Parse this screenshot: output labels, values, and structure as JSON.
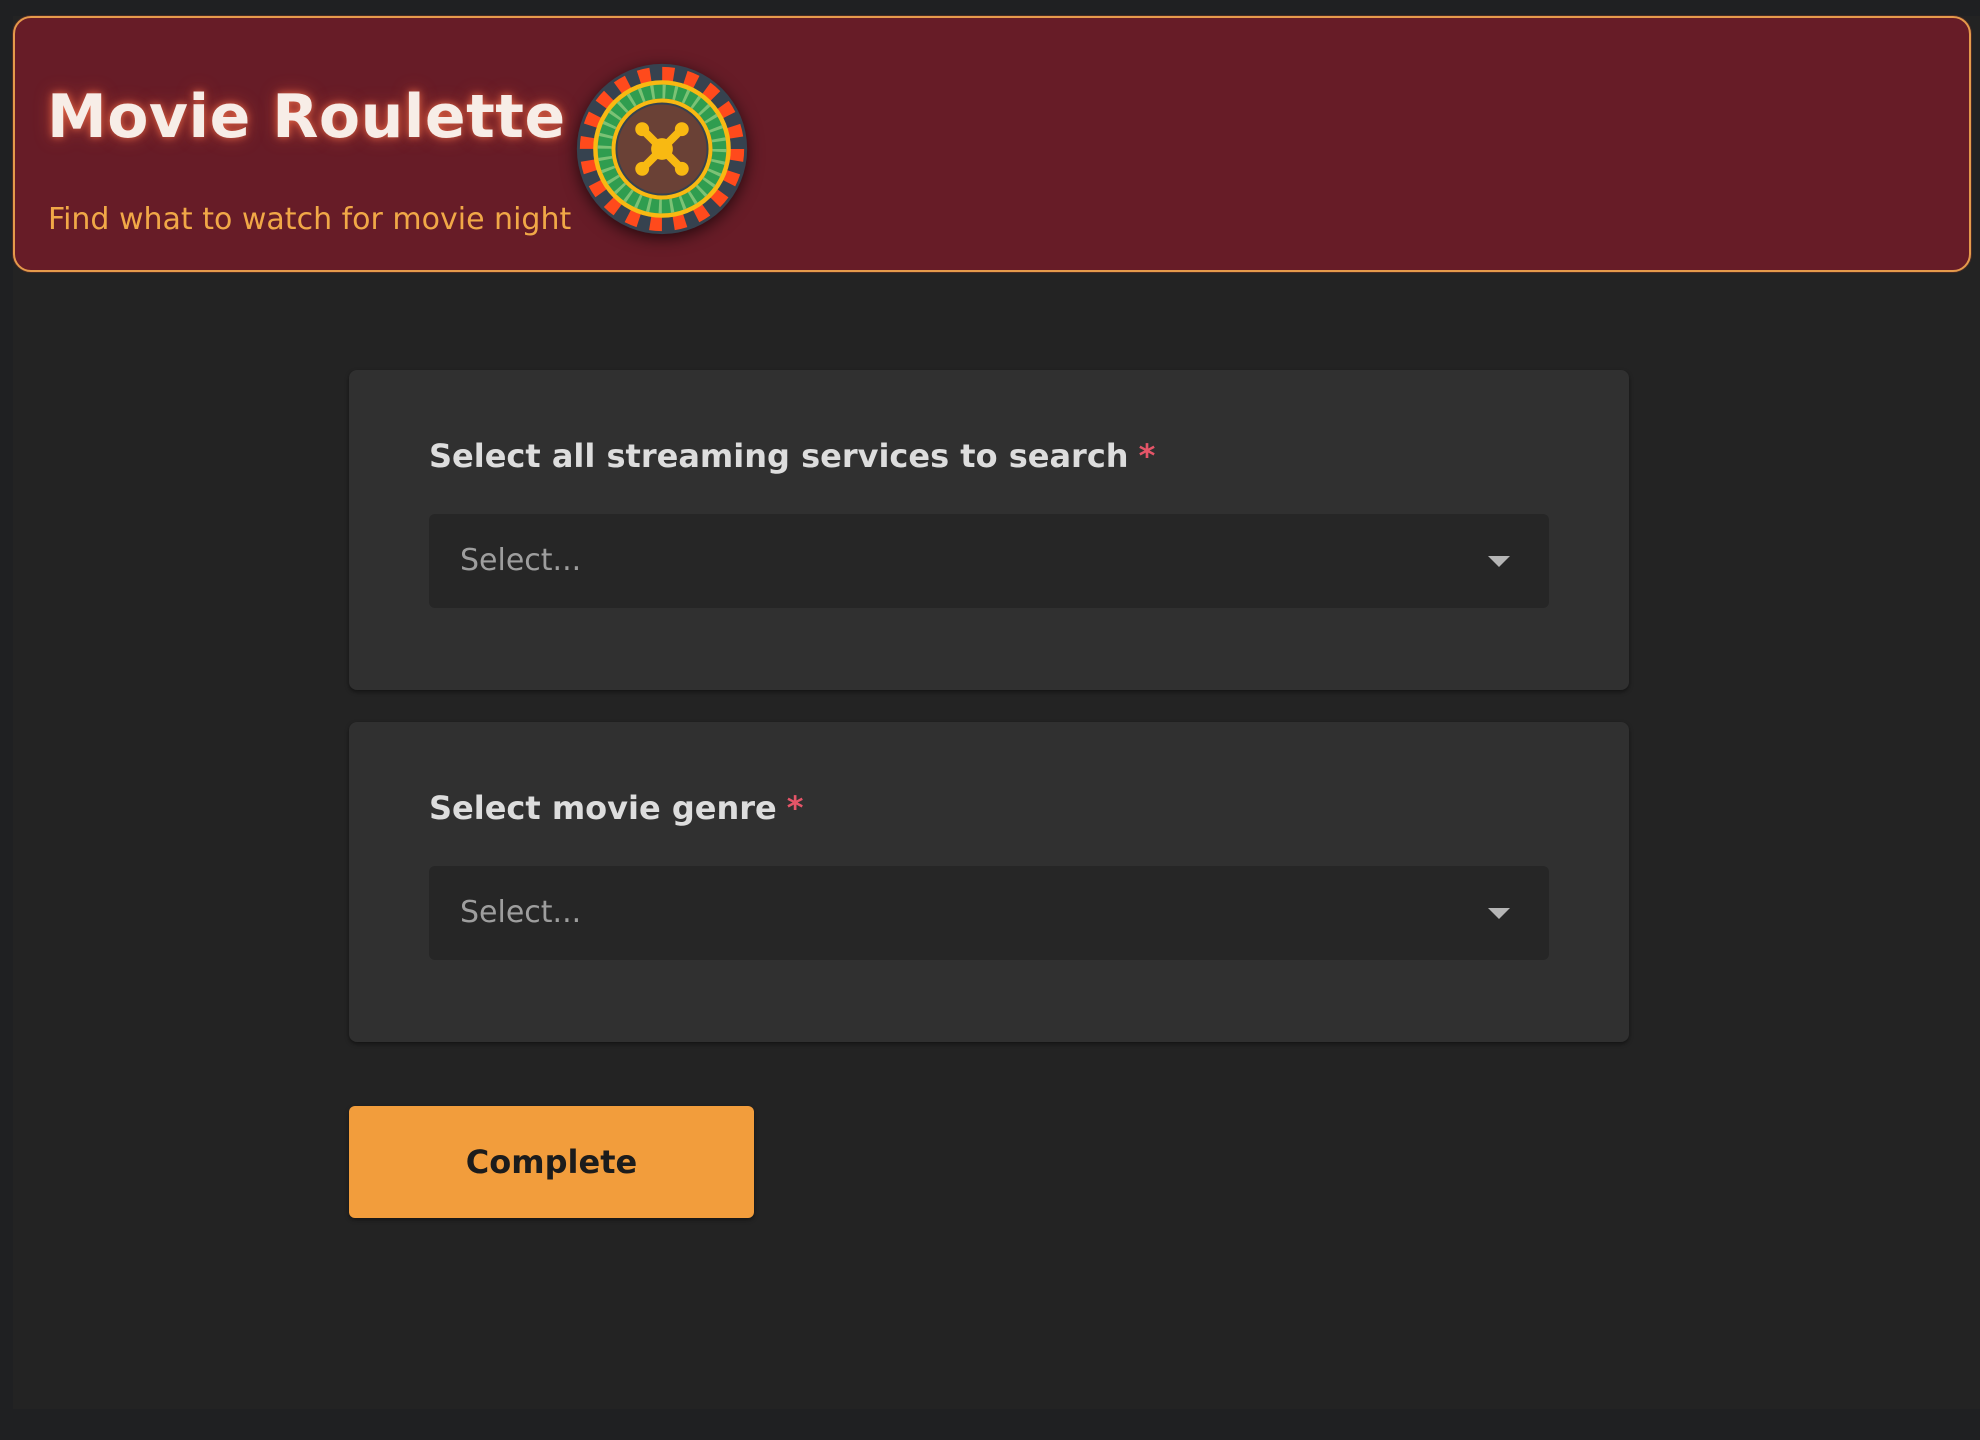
{
  "header": {
    "title": "Movie Roulette",
    "subtitle": "Find what to watch for movie night",
    "logo_icon": "roulette-wheel-icon"
  },
  "form": {
    "questions": [
      {
        "title": "Select all streaming services to search",
        "required_marker": "*",
        "placeholder": "Select..."
      },
      {
        "title": "Select movie genre",
        "required_marker": "*",
        "placeholder": "Select..."
      }
    ],
    "complete_label": "Complete"
  },
  "colors": {
    "page_background": "#232323",
    "header_background": "#671c27",
    "header_border": "#e59a4b",
    "subtitle": "#f1a847",
    "card_background": "#303030",
    "dropdown_background": "#262626",
    "required": "#e55568",
    "accent_button": "#f29d3c"
  }
}
